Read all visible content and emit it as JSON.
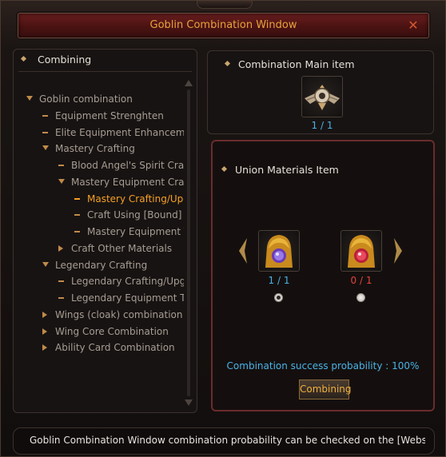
{
  "window": {
    "title": "Goblin Combination Window",
    "close_icon": "close-x-icon",
    "accent_color": "#e8a23a"
  },
  "left_panel": {
    "header": "Combining",
    "tree": [
      {
        "label": "Goblin combination",
        "marker": "arrow-down"
      },
      {
        "label": "Equipment Strenghten",
        "marker": "dash"
      },
      {
        "label": "Elite Equipment Enhancemer",
        "marker": "dash"
      },
      {
        "label": "Mastery Crafting",
        "marker": "arrow-down"
      },
      {
        "label": "Blood Angel's Spirit Craft",
        "marker": "dash"
      },
      {
        "label": "Mastery Equipment Craft",
        "marker": "arrow-down"
      },
      {
        "label": "Mastery Crafting/Upg",
        "marker": "dash",
        "selected": true
      },
      {
        "label": "Craft Using [Bound] N",
        "marker": "dash"
      },
      {
        "label": "Mastery Equipment T",
        "marker": "dash"
      },
      {
        "label": "Craft Other Materials",
        "marker": "arrow-right"
      },
      {
        "label": "Legendary Crafting",
        "marker": "arrow-down"
      },
      {
        "label": "Legendary Crafting/Upgra",
        "marker": "dash"
      },
      {
        "label": "Legendary Equipment Tra",
        "marker": "dash"
      },
      {
        "label": "Wings (cloak) combination",
        "marker": "arrow-right"
      },
      {
        "label": "Wing Core Combination",
        "marker": "arrow-right"
      },
      {
        "label": "Ability Card Combination",
        "marker": "arrow-right"
      }
    ]
  },
  "main_item": {
    "label": "Combination Main item",
    "icon": "winged-emblem-icon",
    "count": "1 / 1",
    "count_color": "#4ab3e6"
  },
  "union": {
    "label": "Union Materials Item",
    "items": [
      {
        "icon": "blue-gem-golden-statue-icon",
        "count": "1 / 1",
        "count_color": "#4ab3e6",
        "selected": true
      },
      {
        "icon": "red-gem-golden-statue-icon",
        "count": "0 / 1",
        "count_color": "#e0443c",
        "selected": false
      }
    ],
    "probability": "Combination success probability : 100%",
    "combine_button": "Combining"
  },
  "notice": "Goblin Combination Window combination probability can be checked on the [Website -"
}
